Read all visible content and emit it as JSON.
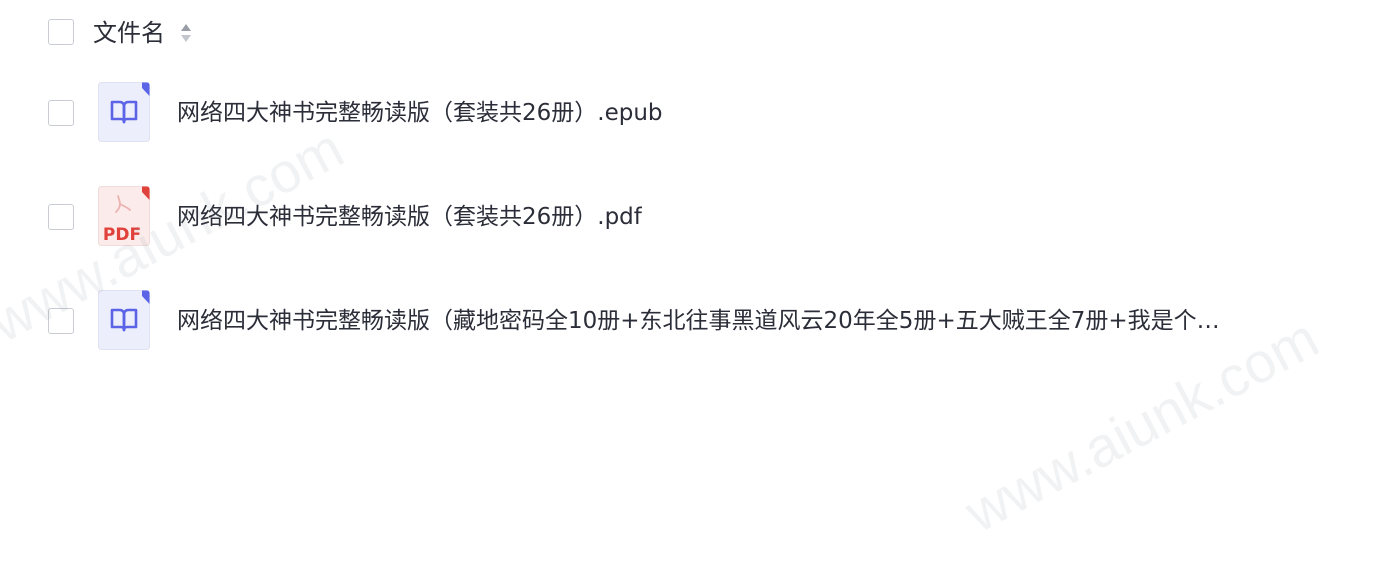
{
  "header": {
    "column_label": "文件名"
  },
  "files": [
    {
      "name": "网络四大神书完整畅读版（套装共26册）.epub",
      "type": "epub"
    },
    {
      "name": "网络四大神书完整畅读版（套装共26册）.pdf",
      "type": "pdf",
      "icon_label": "PDF"
    },
    {
      "name": "网络四大神书完整畅读版（藏地密码全10册+东北往事黑道风云20年全5册+五大贼王全7册+我是个…",
      "type": "epub"
    }
  ],
  "watermark": {
    "text": "www.aiunk.com"
  },
  "colors": {
    "epub_icon_bg": "#eceefb",
    "epub_icon_accent": "#5b63e6",
    "pdf_icon_bg": "#fbeceb",
    "pdf_icon_accent": "#e0423b",
    "text": "#2b2e38",
    "checkbox_border": "#c9ccd4"
  }
}
